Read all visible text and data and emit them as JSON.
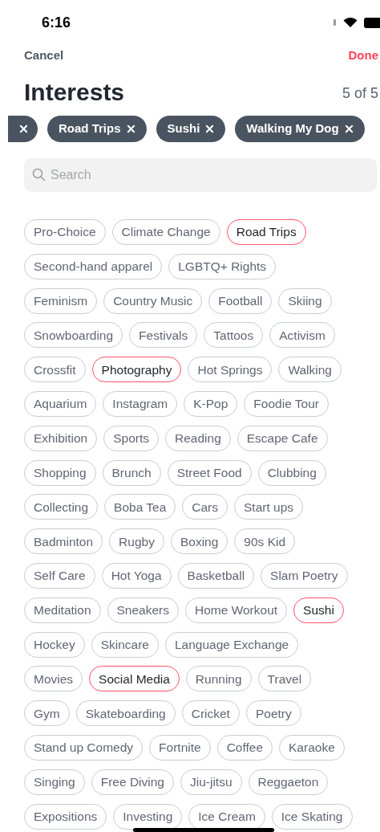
{
  "status_bar": {
    "time": "6:16"
  },
  "nav": {
    "cancel": "Cancel",
    "done": "Done"
  },
  "title": "Interests",
  "counter": "5 of 5",
  "selected_chips": [
    {
      "kind": "cut"
    },
    {
      "kind": "full",
      "label": "Road Trips"
    },
    {
      "kind": "full",
      "label": "Sushi"
    },
    {
      "kind": "full",
      "label": "Walking My Dog"
    }
  ],
  "search": {
    "placeholder": "Search"
  },
  "interest_rows": [
    [
      {
        "label": "Pro-Choice",
        "selected": false
      },
      {
        "label": "Climate Change",
        "selected": false
      },
      {
        "label": "Road Trips",
        "selected": true
      }
    ],
    [
      {
        "label": "Second-hand apparel",
        "selected": false
      },
      {
        "label": "LGBTQ+ Rights",
        "selected": false
      }
    ],
    [
      {
        "label": "Feminism",
        "selected": false
      },
      {
        "label": "Country Music",
        "selected": false
      },
      {
        "label": "Football",
        "selected": false
      },
      {
        "label": "Skiing",
        "selected": false
      }
    ],
    [
      {
        "label": "Snowboarding",
        "selected": false
      },
      {
        "label": "Festivals",
        "selected": false
      },
      {
        "label": "Tattoos",
        "selected": false
      },
      {
        "label": "Activism",
        "selected": false
      }
    ],
    [
      {
        "label": "Crossfit",
        "selected": false
      },
      {
        "label": "Photography",
        "selected": true
      },
      {
        "label": "Hot Springs",
        "selected": false
      },
      {
        "label": "Walking",
        "selected": false
      }
    ],
    [
      {
        "label": "Aquarium",
        "selected": false
      },
      {
        "label": "Instagram",
        "selected": false
      },
      {
        "label": "K-Pop",
        "selected": false
      },
      {
        "label": "Foodie Tour",
        "selected": false
      }
    ],
    [
      {
        "label": "Exhibition",
        "selected": false
      },
      {
        "label": "Sports",
        "selected": false
      },
      {
        "label": "Reading",
        "selected": false
      },
      {
        "label": "Escape Cafe",
        "selected": false
      }
    ],
    [
      {
        "label": "Shopping",
        "selected": false
      },
      {
        "label": "Brunch",
        "selected": false
      },
      {
        "label": "Street Food",
        "selected": false
      },
      {
        "label": "Clubbing",
        "selected": false
      }
    ],
    [
      {
        "label": "Collecting",
        "selected": false
      },
      {
        "label": "Boba Tea",
        "selected": false
      },
      {
        "label": "Cars",
        "selected": false
      },
      {
        "label": "Start ups",
        "selected": false
      }
    ],
    [
      {
        "label": "Badminton",
        "selected": false
      },
      {
        "label": "Rugby",
        "selected": false
      },
      {
        "label": "Boxing",
        "selected": false
      },
      {
        "label": "90s Kid",
        "selected": false
      }
    ],
    [
      {
        "label": "Self Care",
        "selected": false
      },
      {
        "label": "Hot Yoga",
        "selected": false
      },
      {
        "label": "Basketball",
        "selected": false
      },
      {
        "label": "Slam Poetry",
        "selected": false
      }
    ],
    [
      {
        "label": "Meditation",
        "selected": false
      },
      {
        "label": "Sneakers",
        "selected": false
      },
      {
        "label": "Home Workout",
        "selected": false
      },
      {
        "label": "Sushi",
        "selected": true
      }
    ],
    [
      {
        "label": "Hockey",
        "selected": false
      },
      {
        "label": "Skincare",
        "selected": false
      },
      {
        "label": "Language Exchange",
        "selected": false
      }
    ],
    [
      {
        "label": "Movies",
        "selected": false
      },
      {
        "label": "Social Media",
        "selected": true
      },
      {
        "label": "Running",
        "selected": false
      },
      {
        "label": "Travel",
        "selected": false
      }
    ],
    [
      {
        "label": "Gym",
        "selected": false
      },
      {
        "label": "Skateboarding",
        "selected": false
      },
      {
        "label": "Cricket",
        "selected": false
      },
      {
        "label": "Poetry",
        "selected": false
      }
    ],
    [
      {
        "label": "Stand up Comedy",
        "selected": false
      },
      {
        "label": "Fortnite",
        "selected": false
      },
      {
        "label": "Coffee",
        "selected": false
      },
      {
        "label": "Karaoke",
        "selected": false
      }
    ],
    [
      {
        "label": "Singing",
        "selected": false
      },
      {
        "label": "Free Diving",
        "selected": false
      },
      {
        "label": "Jiu-jitsu",
        "selected": false
      },
      {
        "label": "Reggaeton",
        "selected": false
      }
    ],
    [
      {
        "label": "Expositions",
        "selected": false
      },
      {
        "label": "Investing",
        "selected": false
      },
      {
        "label": "Ice Cream",
        "selected": false
      },
      {
        "label": "Ice Skating",
        "selected": false
      }
    ]
  ]
}
